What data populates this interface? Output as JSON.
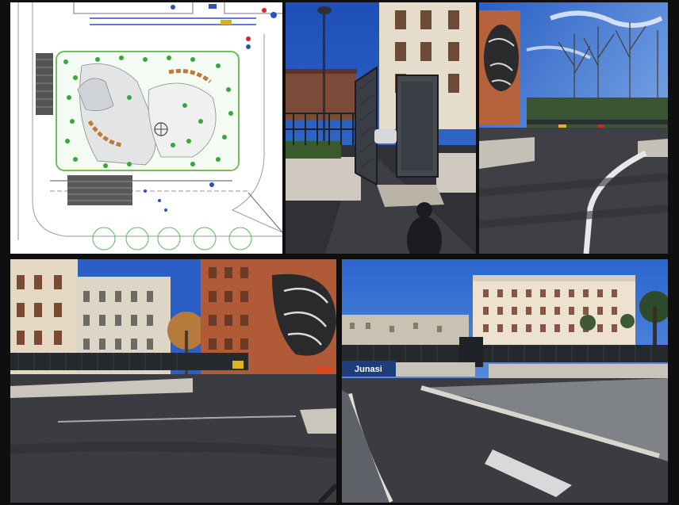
{
  "collage": {
    "panels": [
      {
        "id": "site-plan",
        "kind": "architectural-drawing"
      },
      {
        "id": "gate-photo",
        "kind": "photo"
      },
      {
        "id": "mural-photo",
        "kind": "photo"
      },
      {
        "id": "square-photo",
        "kind": "photo"
      },
      {
        "id": "street-photo",
        "kind": "photo"
      }
    ]
  },
  "signage": {
    "street_sign_text": "Junasi"
  },
  "colors": {
    "sky": "#2c63c9",
    "sky_light": "#7fb0ec",
    "pavement": "#3d3f45",
    "facade_cream": "#e9dec9",
    "facade_brick": "#b8663f",
    "background": "#0f0f10"
  }
}
